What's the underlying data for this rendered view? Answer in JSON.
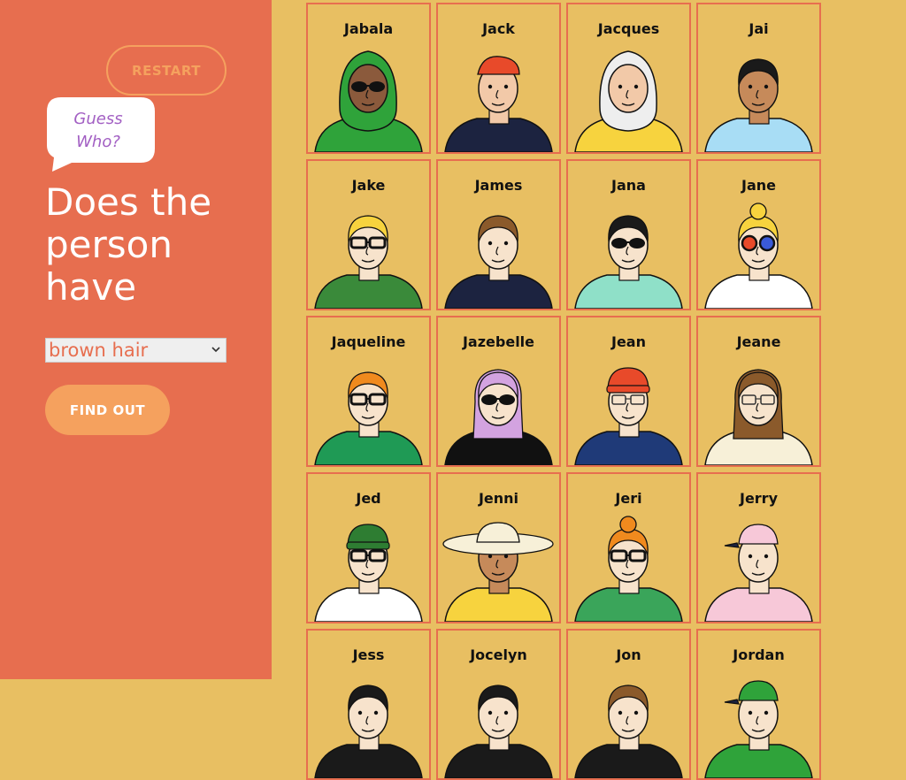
{
  "sidebar": {
    "restart_label": "RESTART",
    "bubble_line1": "Guess",
    "bubble_line2": "Who?",
    "question_line1": "Does the",
    "question_line2": "person",
    "question_line3": "have",
    "select_value": "brown hair",
    "find_out_label": "FIND OUT"
  },
  "colors": {
    "sidebar": "#E76E4F",
    "board": "#E8BF62",
    "accent": "#F5A15E",
    "bubble_text": "#A25FC3"
  },
  "cards": [
    {
      "name": "Jabala",
      "skin": "#8B5A3C",
      "hair": "#2FA33A",
      "shirt": "#2FA33A",
      "glasses": "sun",
      "hat": "hijab"
    },
    {
      "name": "Jack",
      "skin": "#F2C9A8",
      "hair": "#8B5A2B",
      "shirt": "#1C2340",
      "glasses": "none",
      "hat": "bandana"
    },
    {
      "name": "Jacques",
      "skin": "#F2C9A8",
      "hair": "#EEEEEE",
      "shirt": "#F7D33E",
      "glasses": "none",
      "hat": "raincoat"
    },
    {
      "name": "Jai",
      "skin": "#C68A5A",
      "hair": "#1A1A1A",
      "shirt": "#A8DDF5",
      "glasses": "none",
      "hat": "none"
    },
    {
      "name": "Jake",
      "skin": "#F7E3CC",
      "hair": "#F7D33E",
      "shirt": "#3A8A3A",
      "glasses": "black",
      "hat": "none"
    },
    {
      "name": "James",
      "skin": "#F7E3CC",
      "hair": "#8B5A2B",
      "shirt": "#1C2340",
      "glasses": "none",
      "hat": "none"
    },
    {
      "name": "Jana",
      "skin": "#F7E3CC",
      "hair": "#1A1A1A",
      "shirt": "#8FE0C8",
      "glasses": "sun",
      "hat": "none"
    },
    {
      "name": "Jane",
      "skin": "#F7E3CC",
      "hair": "#F7D33E",
      "shirt": "#FFFFFF",
      "glasses": "color",
      "hat": "bun"
    },
    {
      "name": "Jaqueline",
      "skin": "#F7E3CC",
      "hair": "#F08A1E",
      "shirt": "#1F9A55",
      "glasses": "black",
      "hat": "none"
    },
    {
      "name": "Jazebelle",
      "skin": "#F7E3CC",
      "hair": "#D3A3E0",
      "shirt": "#111111",
      "glasses": "sun",
      "hat": "none"
    },
    {
      "name": "Jean",
      "skin": "#F7E3CC",
      "hair": "#E84A2A",
      "shirt": "#1F3A78",
      "glasses": "thin",
      "hat": "beanie"
    },
    {
      "name": "Jeane",
      "skin": "#F7E3CC",
      "hair": "#8B5A2B",
      "shirt": "#F7F0D8",
      "glasses": "thin",
      "hat": "none"
    },
    {
      "name": "Jed",
      "skin": "#F7E3CC",
      "hair": "#F08A1E",
      "shirt": "#FFFFFF",
      "glasses": "black",
      "hat": "beanie-green"
    },
    {
      "name": "Jenni",
      "skin": "#C68A5A",
      "hair": "#F7F0D8",
      "shirt": "#F7D33E",
      "glasses": "none",
      "hat": "sunhat"
    },
    {
      "name": "Jeri",
      "skin": "#F7E3CC",
      "hair": "#F08A1E",
      "shirt": "#3AA55A",
      "glasses": "black",
      "hat": "bun"
    },
    {
      "name": "Jerry",
      "skin": "#F7E3CC",
      "hair": "#F7C8D8",
      "shirt": "#F7C8D8",
      "glasses": "none",
      "hat": "cap"
    },
    {
      "name": "Jess",
      "skin": "#F7E3CC",
      "hair": "#1A1A1A",
      "shirt": "#1A1A1A",
      "glasses": "none",
      "hat": "none"
    },
    {
      "name": "Jocelyn",
      "skin": "#F7E3CC",
      "hair": "#1A1A1A",
      "shirt": "#1A1A1A",
      "glasses": "none",
      "hat": "none"
    },
    {
      "name": "Jon",
      "skin": "#F7E3CC",
      "hair": "#8B5A2B",
      "shirt": "#1A1A1A",
      "glasses": "none",
      "hat": "none"
    },
    {
      "name": "Jordan",
      "skin": "#F7E3CC",
      "hair": "#2FA33A",
      "shirt": "#2FA33A",
      "glasses": "none",
      "hat": "cap-green"
    }
  ]
}
